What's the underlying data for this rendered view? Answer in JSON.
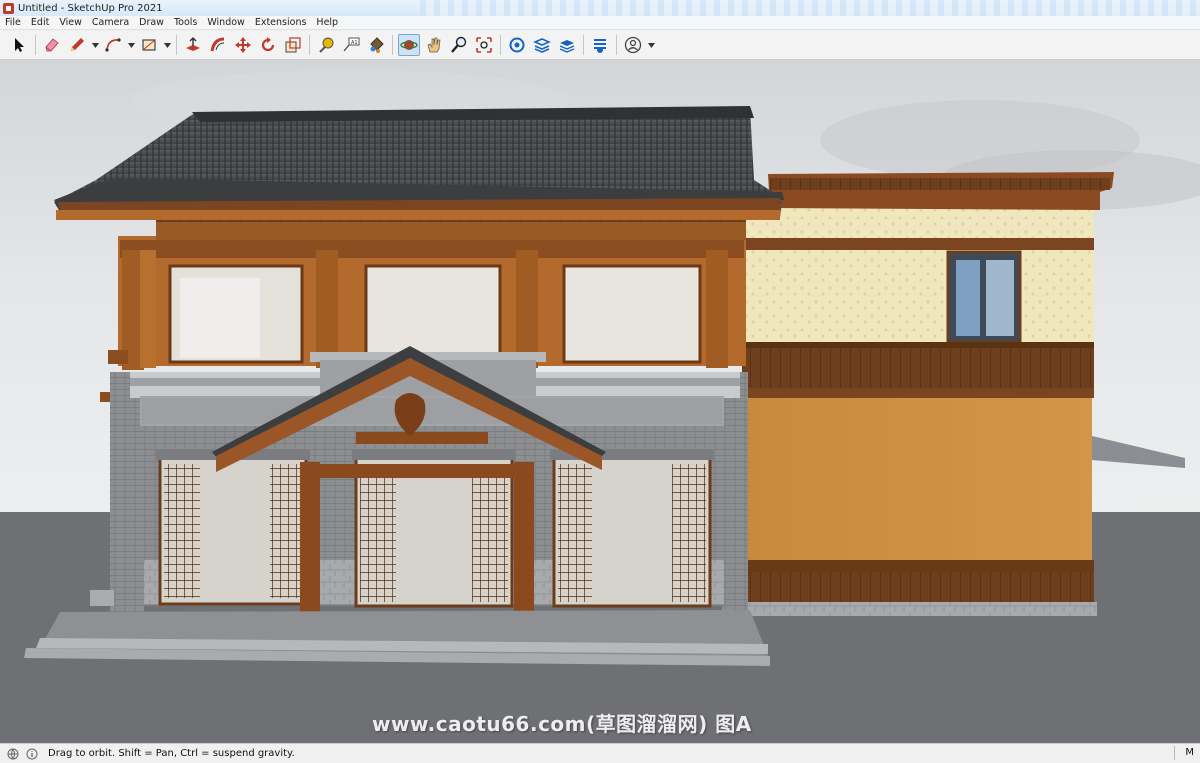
{
  "window": {
    "title": "Untitled - SketchUp Pro 2021"
  },
  "menu": {
    "items": [
      {
        "label": "File"
      },
      {
        "label": "Edit"
      },
      {
        "label": "View"
      },
      {
        "label": "Camera"
      },
      {
        "label": "Draw"
      },
      {
        "label": "Tools"
      },
      {
        "label": "Window"
      },
      {
        "label": "Extensions"
      },
      {
        "label": "Help"
      }
    ]
  },
  "toolbar": {
    "tools": [
      {
        "name": "select-tool",
        "icon": "arrow-cursor-icon"
      },
      {
        "name": "eraser-tool",
        "icon": "eraser-icon"
      },
      {
        "name": "line-tool",
        "icon": "pencil-icon"
      },
      {
        "name": "arc-tool",
        "icon": "arc-icon"
      },
      {
        "name": "rectangle-tool",
        "icon": "rectangle-icon"
      },
      {
        "name": "push-pull-tool",
        "icon": "push-pull-icon"
      },
      {
        "name": "follow-me-tool",
        "icon": "follow-me-icon"
      },
      {
        "name": "move-tool",
        "icon": "move-icon"
      },
      {
        "name": "rotate-tool",
        "icon": "rotate-icon"
      },
      {
        "name": "scale-tool",
        "icon": "scale-icon"
      },
      {
        "name": "tape-measure-tool",
        "icon": "tape-measure-icon"
      },
      {
        "name": "text-tool",
        "icon": "text-icon"
      },
      {
        "name": "paint-bucket-tool",
        "icon": "paint-bucket-icon"
      },
      {
        "name": "orbit-tool",
        "icon": "orbit-icon",
        "active": true
      },
      {
        "name": "pan-tool",
        "icon": "pan-hand-icon"
      },
      {
        "name": "zoom-tool",
        "icon": "zoom-icon"
      },
      {
        "name": "zoom-extents-tool",
        "icon": "zoom-extents-icon"
      },
      {
        "name": "3d-warehouse",
        "icon": "warehouse-icon"
      },
      {
        "name": "extension-warehouse",
        "icon": "extension-warehouse-icon"
      },
      {
        "name": "layout-send",
        "icon": "layout-icon"
      },
      {
        "name": "extension-manager",
        "icon": "extension-manager-icon"
      },
      {
        "name": "account",
        "icon": "user-icon"
      }
    ]
  },
  "viewport": {
    "sky_color": "#dfe1e3",
    "ground_color": "#6e6f73"
  },
  "watermark": {
    "text": "www.caotu66.com(草图溜溜网) 图A"
  },
  "statusbar": {
    "message": "Drag to orbit. Shift = Pan, Ctrl = suspend gravity.",
    "measurements_label": "M"
  }
}
